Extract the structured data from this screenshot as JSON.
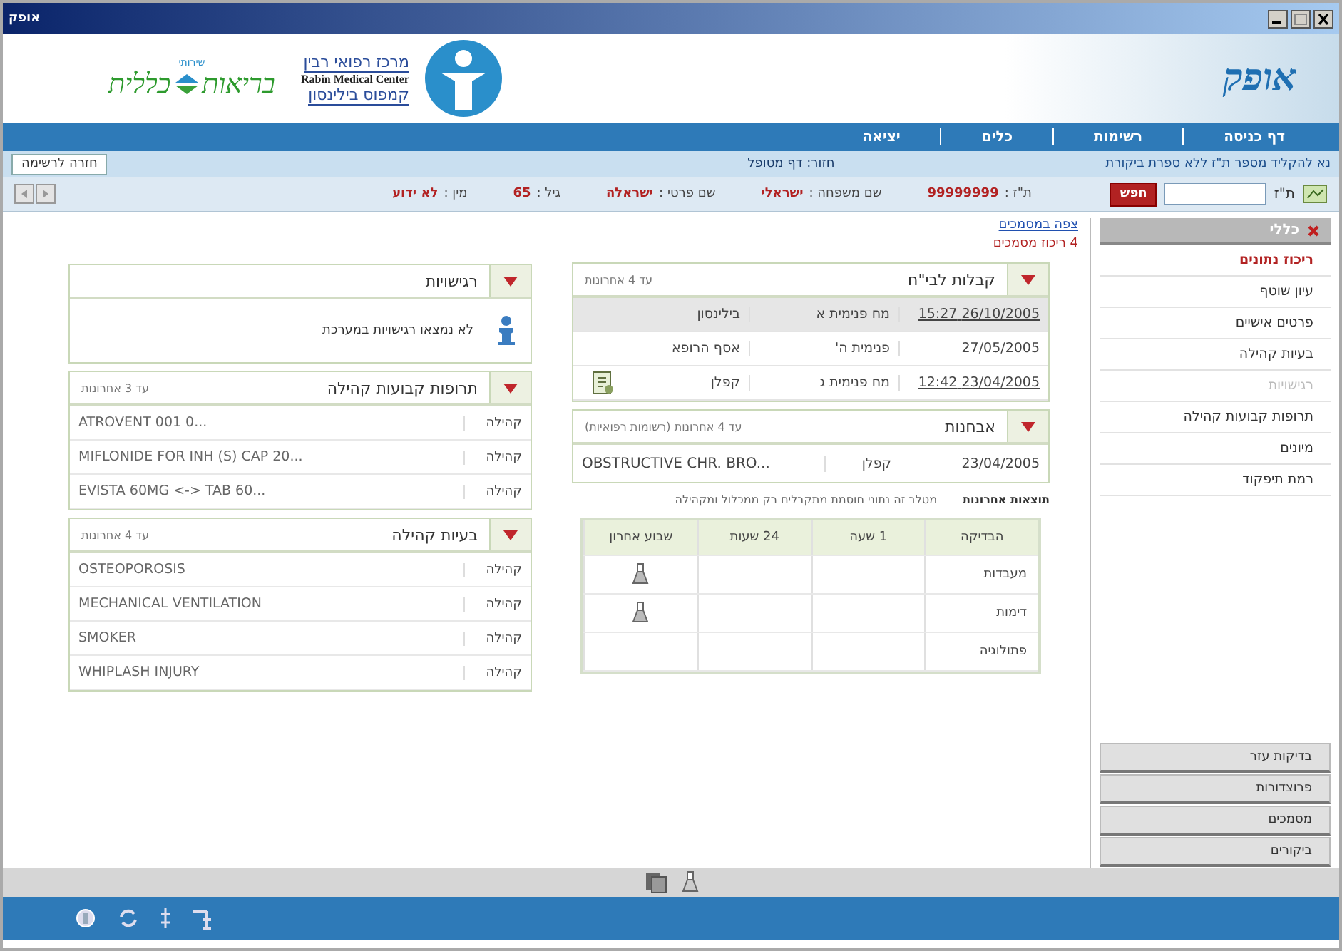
{
  "window": {
    "title": "אופק"
  },
  "header": {
    "clalit_small": "שירותי",
    "clalit_logo": "כללית",
    "clalit_prefix": "בריאות",
    "rabin_he": "מרכז רפואי רבין",
    "rabin_en": "Rabin Medical Center",
    "rabin_campus": "קמפוס בילינסון",
    "app_logo": "אופק"
  },
  "nav": [
    {
      "label": "דף כניסה"
    },
    {
      "label": "רשימות"
    },
    {
      "label": "כלים"
    },
    {
      "label": "יציאה"
    }
  ],
  "hint": "נא להקליד מספר ת\"ז ללא ספרת ביקורת",
  "breadcrumb": "חזור: דף מטופל",
  "back_button": "חזרה לרשימה",
  "search": {
    "label": "ת\"ז",
    "button": "חפש"
  },
  "patient": [
    {
      "label": "ת\"ז :",
      "value": "99999999"
    },
    {
      "label": "שם משפחה :",
      "value": "ישראלי"
    },
    {
      "label": "שם פרטי :",
      "value": "ישראלה"
    },
    {
      "label": "גיל :",
      "value": "65"
    },
    {
      "label": "מין :",
      "value": "לא ידוע"
    }
  ],
  "sidebar": {
    "title": "כללי",
    "items": [
      {
        "label": "ריכוז נתונים",
        "selected": true,
        "disabled": false
      },
      {
        "label": "עיון שוטף",
        "selected": false,
        "disabled": false
      },
      {
        "label": "פרטים אישיים",
        "selected": false,
        "disabled": false
      },
      {
        "label": "בעיות קהילה",
        "selected": false,
        "disabled": false
      },
      {
        "label": "רגישויות",
        "selected": false,
        "disabled": true
      },
      {
        "label": "תרופות קבועות קהילה",
        "selected": false,
        "disabled": false
      },
      {
        "label": "מיונים",
        "selected": false,
        "disabled": false
      },
      {
        "label": "רמת תיפקוד",
        "selected": false,
        "disabled": false
      }
    ],
    "sections": [
      "בדיקות עזר",
      "פרוצדורות",
      "מסמכים",
      "ביקורים"
    ]
  },
  "main": {
    "link": "צפה במסמכים",
    "count_note": "4 ריכוז מסמכים",
    "admissions": {
      "title": "קבלות לבי\"ח",
      "note": "עד 4 אחרונות",
      "rows": [
        {
          "date": "26/10/2005 15:27",
          "dept": "מח פנימית א",
          "site": "בילינסון",
          "linked": true,
          "selected": true,
          "icon": false
        },
        {
          "date": "27/05/2005",
          "dept": "פנימית ה'",
          "site": "אסף הרופא",
          "linked": false,
          "selected": false,
          "icon": false
        },
        {
          "date": "23/04/2005 12:42",
          "dept": "מח פנימית ג",
          "site": "קפלן",
          "linked": true,
          "selected": false,
          "icon": true
        }
      ]
    },
    "diagnoses": {
      "title": "אבחנות",
      "note": "עד 4 אחרונות (רשומות רפואיות)",
      "rows": [
        {
          "date": "23/04/2005",
          "site": "קפלן",
          "text": "OBSTRUCTIVE CHR. BRO..."
        }
      ]
    },
    "results": {
      "title": "תוצאות אחרונות",
      "note": "מטלב זה נתוני חוסמת מתקבלים רק ממכלול ומקהילה",
      "columns": [
        "הבדיקה",
        "1 שעה",
        "24 שעות",
        "שבוע אחרון"
      ],
      "rows": [
        {
          "name": "מעבדות",
          "has_result": true
        },
        {
          "name": "דימות",
          "has_result": true
        },
        {
          "name": "פתולוגיה",
          "has_result": false
        }
      ]
    },
    "allergies": {
      "title": "רגישויות",
      "message": "לא נמצאו רגישויות במערכת"
    },
    "medications": {
      "title": "תרופות קבועות קהילה",
      "note": "עד 3 אחרונות",
      "rows": [
        {
          "source": "קהילה",
          "text": "ATROVENT 001 0..."
        },
        {
          "source": "קהילה",
          "text": "MIFLONIDE FOR INH (S) CAP 20..."
        },
        {
          "source": "קהילה",
          "text": "EVISTA 60MG <-> TAB 60..."
        }
      ]
    },
    "problems": {
      "title": "בעיות קהילה",
      "note": "עד 4 אחרונות",
      "rows": [
        {
          "source": "קהילה",
          "text": "OSTEOPOROSIS"
        },
        {
          "source": "קהילה",
          "text": "MECHANICAL VENTILATION"
        },
        {
          "source": "קהילה",
          "text": "SMOKER"
        },
        {
          "source": "קהילה",
          "text": "WHIPLASH INJURY"
        }
      ]
    }
  }
}
